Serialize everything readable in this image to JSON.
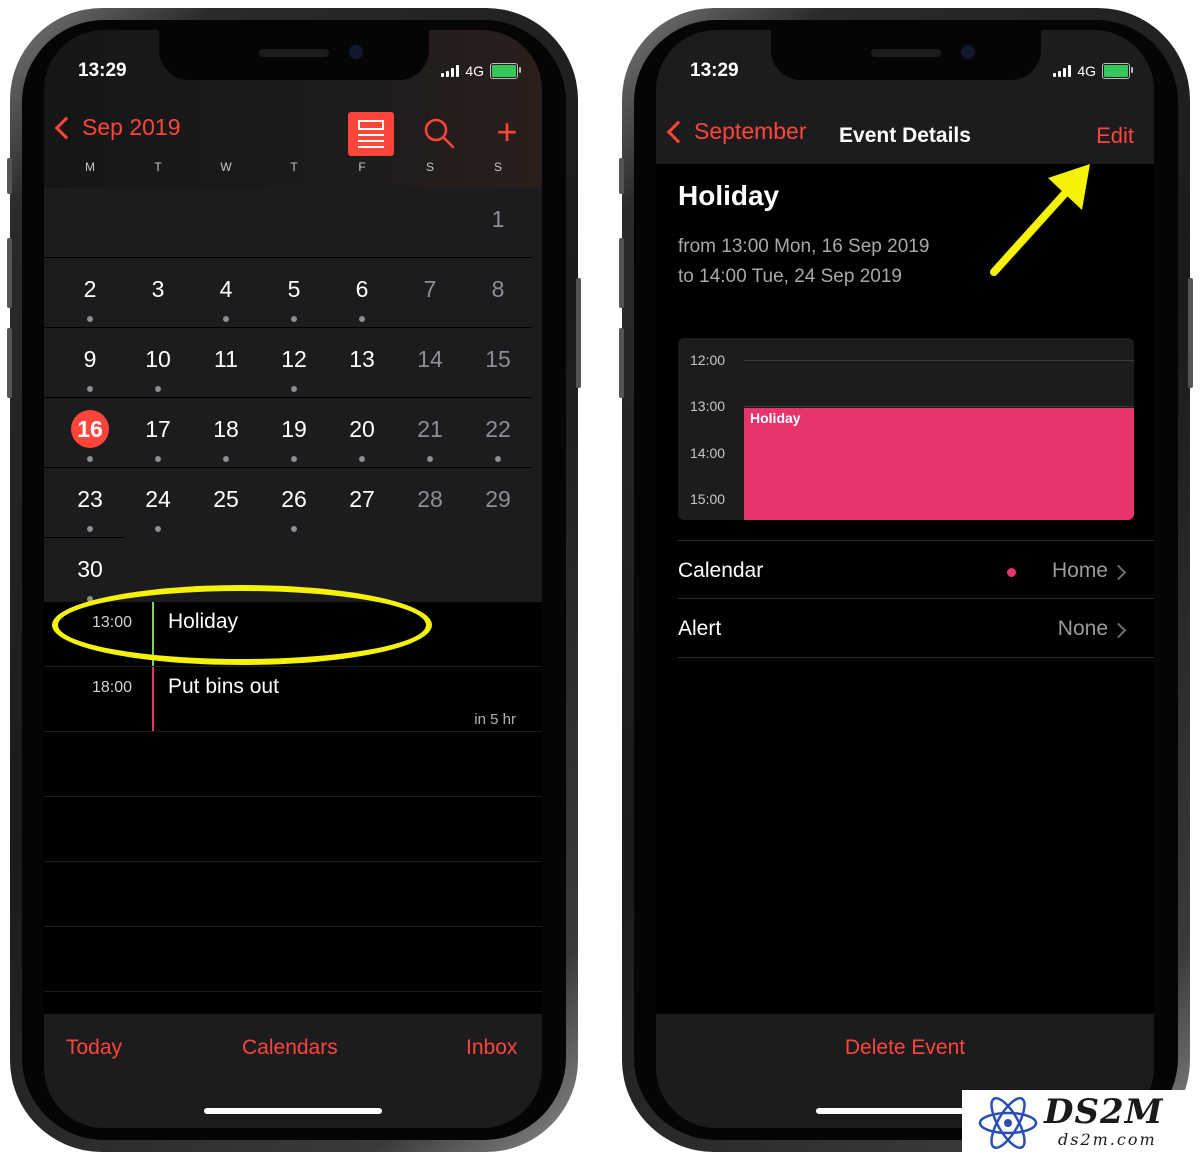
{
  "status": {
    "time": "13:29",
    "network": "4G"
  },
  "left": {
    "nav": {
      "back_label": "Sep 2019"
    },
    "weekdays": [
      "M",
      "T",
      "W",
      "T",
      "F",
      "S",
      "S"
    ],
    "weeks": [
      [
        {
          "d": "",
          "w": false,
          "dot": false
        },
        {
          "d": "",
          "w": false,
          "dot": false
        },
        {
          "d": "",
          "w": false,
          "dot": false
        },
        {
          "d": "",
          "w": false,
          "dot": false
        },
        {
          "d": "",
          "w": false,
          "dot": false
        },
        {
          "d": "",
          "w": true,
          "dot": false
        },
        {
          "d": "1",
          "w": true,
          "dot": false
        }
      ],
      [
        {
          "d": "2",
          "w": false,
          "dot": true
        },
        {
          "d": "3",
          "w": false,
          "dot": false
        },
        {
          "d": "4",
          "w": false,
          "dot": true
        },
        {
          "d": "5",
          "w": false,
          "dot": true
        },
        {
          "d": "6",
          "w": false,
          "dot": true
        },
        {
          "d": "7",
          "w": true,
          "dot": false
        },
        {
          "d": "8",
          "w": true,
          "dot": false
        }
      ],
      [
        {
          "d": "9",
          "w": false,
          "dot": true
        },
        {
          "d": "10",
          "w": false,
          "dot": true
        },
        {
          "d": "11",
          "w": false,
          "dot": false
        },
        {
          "d": "12",
          "w": false,
          "dot": true
        },
        {
          "d": "13",
          "w": false,
          "dot": false
        },
        {
          "d": "14",
          "w": true,
          "dot": false
        },
        {
          "d": "15",
          "w": true,
          "dot": false
        }
      ],
      [
        {
          "d": "16",
          "w": false,
          "dot": true,
          "today": true
        },
        {
          "d": "17",
          "w": false,
          "dot": true
        },
        {
          "d": "18",
          "w": false,
          "dot": true
        },
        {
          "d": "19",
          "w": false,
          "dot": true
        },
        {
          "d": "20",
          "w": false,
          "dot": true
        },
        {
          "d": "21",
          "w": true,
          "dot": true
        },
        {
          "d": "22",
          "w": true,
          "dot": true
        }
      ],
      [
        {
          "d": "23",
          "w": false,
          "dot": true
        },
        {
          "d": "24",
          "w": false,
          "dot": true
        },
        {
          "d": "25",
          "w": false,
          "dot": false
        },
        {
          "d": "26",
          "w": false,
          "dot": true
        },
        {
          "d": "27",
          "w": false,
          "dot": false
        },
        {
          "d": "28",
          "w": true,
          "dot": false
        },
        {
          "d": "29",
          "w": true,
          "dot": false
        }
      ],
      [
        {
          "d": "30",
          "w": false,
          "dot": true
        }
      ]
    ],
    "events": [
      {
        "time": "13:00",
        "title": "Holiday",
        "relative": "",
        "color": "#7ed35a"
      },
      {
        "time": "18:00",
        "title": "Put bins out",
        "relative": "in 5 hr",
        "color": "#e8336d"
      }
    ],
    "tabs": {
      "today": "Today",
      "calendars": "Calendars",
      "inbox": "Inbox"
    }
  },
  "right": {
    "nav": {
      "back_label": "September",
      "title": "Event Details",
      "edit_label": "Edit"
    },
    "event": {
      "title": "Holiday",
      "from": "from 13:00 Mon, 16 Sep 2019",
      "to": "to 14:00 Tue, 24 Sep 2019"
    },
    "mini_calendar": {
      "hours": [
        "12:00",
        "13:00",
        "14:00",
        "15:00"
      ],
      "event_label": "Holiday",
      "event_color": "#e8336d"
    },
    "rows": {
      "calendar_label": "Calendar",
      "calendar_value": "Home",
      "alert_label": "Alert",
      "alert_value": "None"
    },
    "delete_label": "Delete Event"
  },
  "watermark": {
    "logo_text": "DS2M",
    "url_text": "ds2m.com"
  },
  "colors": {
    "accent": "#ff453a",
    "annotation": "#f5f107",
    "event_pink": "#e8336d"
  }
}
